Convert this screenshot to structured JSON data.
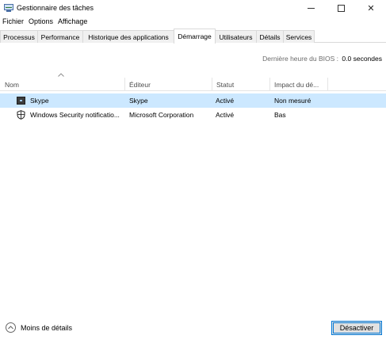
{
  "window": {
    "title": "Gestionnaire des tâches",
    "controls": {
      "minimize_icon": "minimize-icon",
      "maximize_icon": "maximize-icon",
      "close_glyph": "✕"
    }
  },
  "menu": [
    "Fichier",
    "Options",
    "Affichage"
  ],
  "tabs": [
    {
      "label": "Processus"
    },
    {
      "label": "Performance"
    },
    {
      "label": "Historique des applications"
    },
    {
      "label": "Démarrage",
      "active": true
    },
    {
      "label": "Utilisateurs"
    },
    {
      "label": "Détails"
    },
    {
      "label": "Services"
    }
  ],
  "bios": {
    "label": "Dernière heure du BIOS :",
    "value": "0.0 secondes"
  },
  "columns": [
    "Nom",
    "Éditeur",
    "Statut",
    "Impact du dé..."
  ],
  "rows": [
    {
      "icon": "skype-icon",
      "name": "Skype",
      "publisher": "Skype",
      "status": "Activé",
      "impact": "Non mesuré",
      "selected": true
    },
    {
      "icon": "windows-security-shield-icon",
      "name": "Windows Security notificatio...",
      "publisher": "Microsoft Corporation",
      "status": "Activé",
      "impact": "Bas",
      "selected": false
    }
  ],
  "footer": {
    "less_details": "Moins de détails",
    "disable": "Désactiver"
  },
  "colors": {
    "selection": "#cce8ff",
    "accent": "#0078d7",
    "header_text": "#4d4d4d",
    "bios_label": "#6b6b6b"
  }
}
